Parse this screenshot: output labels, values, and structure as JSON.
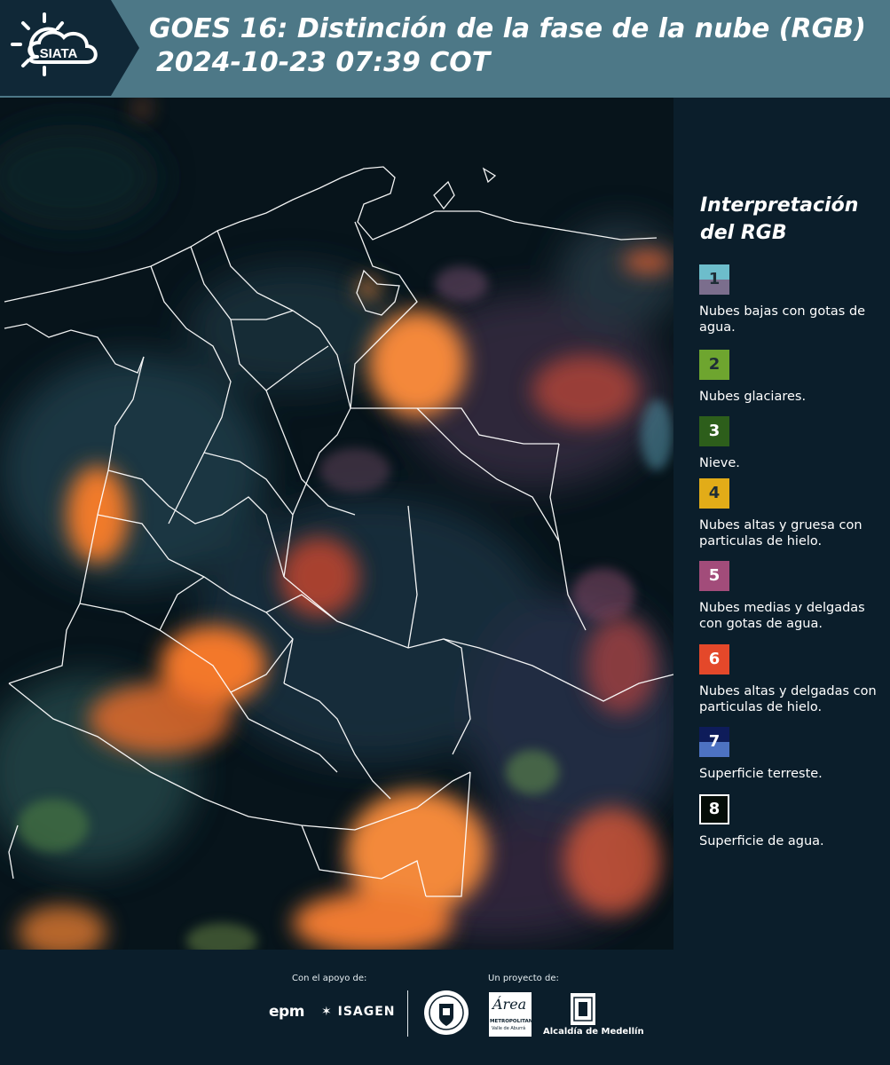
{
  "header": {
    "logo_text": "SIATA",
    "title_line1": "GOES 16: Distinción de la fase de la nube (RGB)",
    "title_line2": "2024-10-23 07:39 COT"
  },
  "legend": {
    "title": "Interpretación del RGB",
    "items": [
      {
        "num": "1",
        "label": "Nubes bajas con gotas de agua.",
        "colors": [
          "#6dbdcb",
          "#7b6e8d"
        ]
      },
      {
        "num": "2",
        "label": "Nubes glaciares.",
        "colors": [
          "#6ea52f"
        ]
      },
      {
        "num": "3",
        "label": "Nieve.",
        "colors": [
          "#2d5e1b"
        ]
      },
      {
        "num": "4",
        "label": "Nubes altas y gruesa con particulas de hielo.",
        "colors": [
          "#e2ac18"
        ]
      },
      {
        "num": "5",
        "label": "Nubes medias y delgadas con gotas de agua.",
        "colors": [
          "#a24c7a"
        ]
      },
      {
        "num": "6",
        "label": "Nubes altas y delgadas con particulas de hielo.",
        "colors": [
          "#e4482a"
        ]
      },
      {
        "num": "7",
        "label": "Superficie terreste.",
        "colors": [
          "#0e1c5a",
          "#4d72c2"
        ]
      },
      {
        "num": "8",
        "label": "Superficie de agua.",
        "colors": [
          "#050d08"
        ]
      }
    ]
  },
  "footer": {
    "support_label": "Con el apoyo de:",
    "project_label": "Un proyecto de:",
    "sponsor_epm": "epm",
    "sponsor_isagen": "ISAGEN",
    "area_line1": "Área",
    "area_line2": "METROPOLITANA",
    "area_line3": "Valle de Aburrá",
    "alcaldia": "Alcaldía de Medellín"
  },
  "colors": {
    "header_bg": "#4d7887",
    "panel_bg": "#0b1e2b",
    "ice_cloud": "#f07a2a",
    "border_lines": "#ffffff"
  }
}
